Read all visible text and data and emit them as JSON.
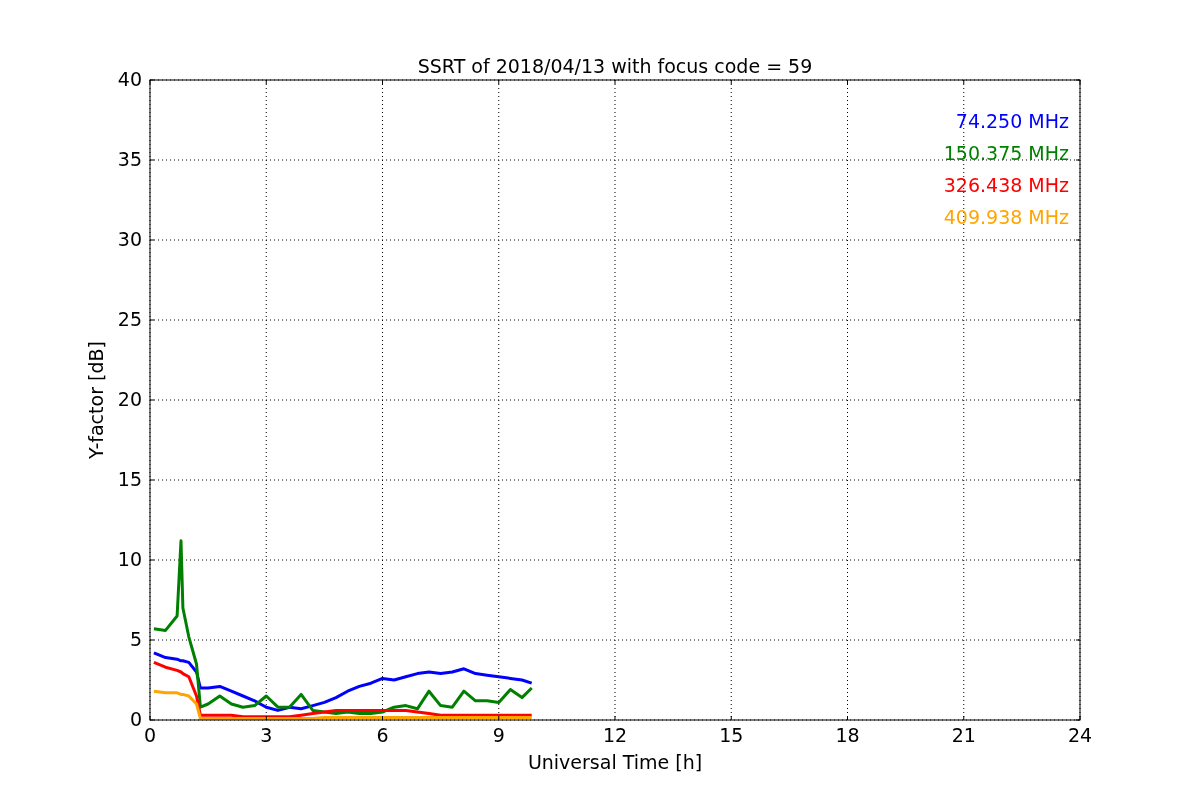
{
  "figure": {
    "chart_data": {
      "type": "line",
      "title": "SSRT of 2018/04/13 with focus code = 59",
      "xlabel": "Universal Time [h]",
      "ylabel": "Y-factor [dB]",
      "x": [
        0.1,
        0.4,
        0.7,
        0.8,
        0.85,
        1.0,
        1.2,
        1.3,
        1.5,
        1.8,
        2.1,
        2.4,
        2.7,
        3.0,
        3.3,
        3.6,
        3.9,
        4.2,
        4.5,
        4.8,
        5.1,
        5.4,
        5.7,
        6.0,
        6.3,
        6.6,
        6.9,
        7.2,
        7.5,
        7.8,
        8.1,
        8.4,
        8.7,
        9.0,
        9.3,
        9.6,
        9.85
      ],
      "series": [
        {
          "name": "74.250 MHz",
          "color": "#0000ff",
          "values": [
            4.2,
            3.9,
            3.8,
            3.7,
            3.7,
            3.6,
            3.0,
            2.0,
            2.0,
            2.1,
            1.8,
            1.5,
            1.2,
            0.8,
            0.6,
            0.8,
            0.7,
            0.9,
            1.1,
            1.4,
            1.8,
            2.1,
            2.3,
            2.6,
            2.5,
            2.7,
            2.9,
            3.0,
            2.9,
            3.0,
            3.2,
            2.9,
            2.8,
            2.7,
            2.6,
            2.5,
            2.3
          ]
        },
        {
          "name": "150.375 MHz",
          "color": "#008000",
          "values": [
            5.7,
            5.6,
            6.5,
            11.2,
            7.0,
            5.2,
            3.5,
            0.8,
            1.0,
            1.5,
            1.0,
            0.8,
            0.9,
            1.5,
            0.8,
            0.8,
            1.6,
            0.6,
            0.5,
            0.4,
            0.5,
            0.4,
            0.4,
            0.5,
            0.8,
            0.9,
            0.7,
            1.8,
            0.9,
            0.8,
            1.8,
            1.2,
            1.2,
            1.1,
            1.9,
            1.4,
            2.0
          ]
        },
        {
          "name": "326.438 MHz",
          "color": "#ff0000",
          "values": [
            3.6,
            3.3,
            3.1,
            3.0,
            2.9,
            2.7,
            1.5,
            0.3,
            0.3,
            0.3,
            0.3,
            0.2,
            0.2,
            0.2,
            0.2,
            0.2,
            0.3,
            0.4,
            0.5,
            0.6,
            0.6,
            0.6,
            0.6,
            0.6,
            0.6,
            0.6,
            0.5,
            0.4,
            0.3,
            0.3,
            0.3,
            0.3,
            0.3,
            0.3,
            0.3,
            0.3,
            0.3
          ]
        },
        {
          "name": "409.938 MHz",
          "color": "#ffa500",
          "values": [
            1.8,
            1.7,
            1.7,
            1.6,
            1.6,
            1.5,
            1.0,
            0.1,
            0.1,
            0.1,
            0.1,
            0.1,
            0.1,
            0.1,
            0.1,
            0.1,
            0.1,
            0.1,
            0.15,
            0.15,
            0.15,
            0.15,
            0.15,
            0.15,
            0.15,
            0.15,
            0.15,
            0.15,
            0.15,
            0.15,
            0.15,
            0.15,
            0.15,
            0.15,
            0.15,
            0.15,
            0.15
          ]
        }
      ],
      "xlim": [
        0,
        24
      ],
      "ylim": [
        0,
        40
      ],
      "xticks": [
        0,
        3,
        6,
        9,
        12,
        15,
        18,
        21,
        24
      ],
      "yticks": [
        0,
        5,
        10,
        15,
        20,
        25,
        30,
        35,
        40
      ],
      "grid": true
    }
  }
}
